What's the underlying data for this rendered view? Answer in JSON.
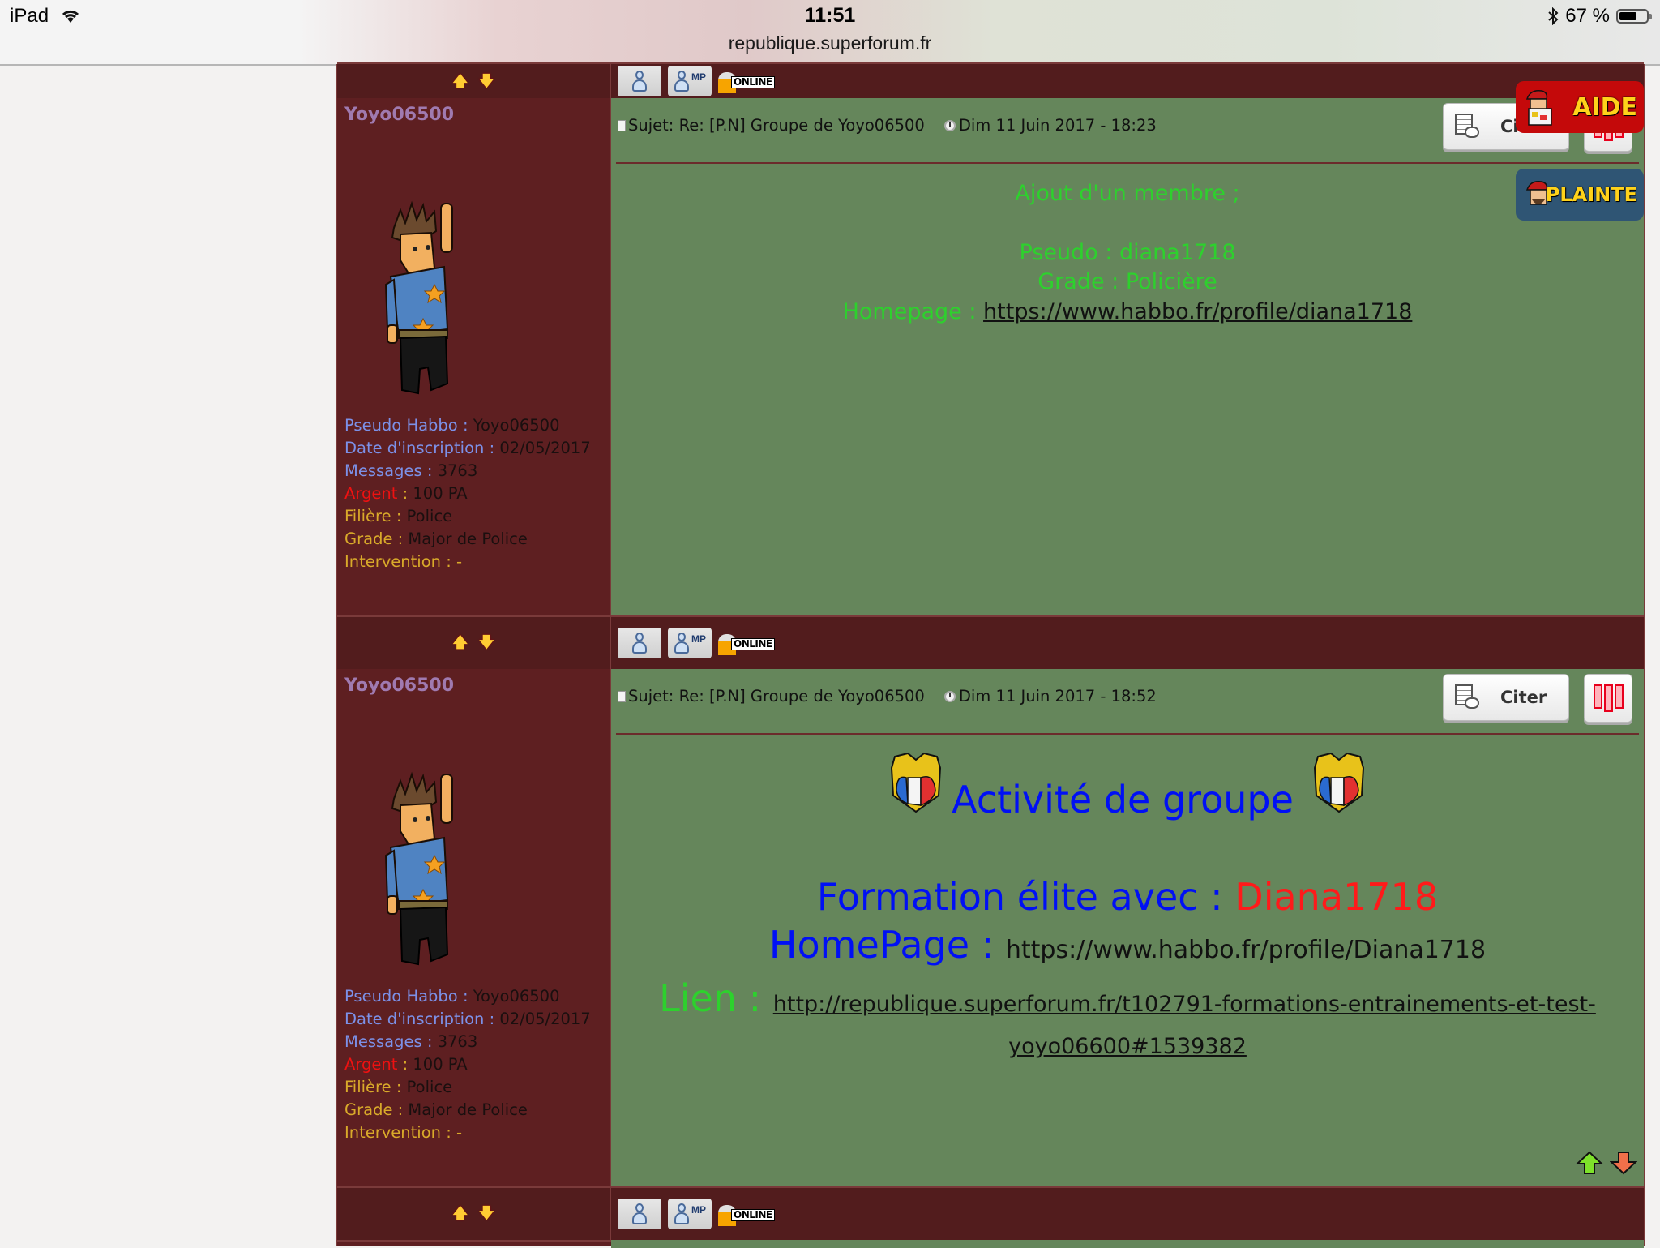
{
  "status_bar": {
    "device": "iPad",
    "time": "11:51",
    "battery_percent": "67 %",
    "battery_level": 0.67,
    "url": "republique.superforum.fr"
  },
  "icons": {
    "wifi": "wifi-icon",
    "bluetooth": "bluetooth-icon",
    "battery": "battery-icon",
    "nav_up": "arrow-up-icon",
    "nav_down": "arrow-down-icon",
    "profile": "profile-icon",
    "pm": "private-message-icon",
    "online": "online-status-icon",
    "subject": "document-icon",
    "clock": "clock-icon",
    "quote": "quote-icon",
    "report": "report-icon"
  },
  "post_bar": {
    "nav_up": "🡅",
    "nav_down": "🡇",
    "pm_label": "MP",
    "online_label": "ONLINE"
  },
  "floating_buttons": {
    "aide": "AIDE",
    "plainte": "PLAINTE"
  },
  "posts": [
    {
      "author": "Yoyo06500",
      "profile": {
        "pseudo_label": "Pseudo Habbo",
        "pseudo_value": "Yoyo06500",
        "date_label": "Date d'inscription",
        "date_value": "02/05/2017",
        "messages_label": "Messages",
        "messages_value": "3763",
        "argent_label": "Argent",
        "argent_value": "100 PA",
        "filiere_label": "Filière",
        "filiere_value": "Police",
        "grade_label": "Grade",
        "grade_value": "Major de Police",
        "intervention_label": "Intervention",
        "intervention_value": "-",
        "separator": " : "
      },
      "subject": "Sujet: Re: [P.N] Groupe de Yoyo06500",
      "date": "Dim 11 Juin 2017 - 18:23",
      "quote_label": "Citer",
      "body": {
        "line1": "Ajout d'un membre ;",
        "pseudo": "Pseudo : diana1718",
        "grade": "Grade : Policière",
        "homepage_label": "Homepage : ",
        "homepage_url": "https://www.habbo.fr/profile/diana1718"
      }
    },
    {
      "author": "Yoyo06500",
      "profile": {
        "pseudo_label": "Pseudo Habbo",
        "pseudo_value": "Yoyo06500",
        "date_label": "Date d'inscription",
        "date_value": "02/05/2017",
        "messages_label": "Messages",
        "messages_value": "3763",
        "argent_label": "Argent",
        "argent_value": "100 PA",
        "filiere_label": "Filière",
        "filiere_value": "Police",
        "grade_label": "Grade",
        "grade_value": "Major de Police",
        "intervention_label": "Intervention",
        "intervention_value": "-",
        "separator": " : "
      },
      "subject": "Sujet: Re: [P.N] Groupe de Yoyo06500",
      "date": "Dim 11 Juin 2017 - 18:52",
      "quote_label": "Citer",
      "body": {
        "title": "Activité de groupe",
        "formation_label": "Formation élite avec : ",
        "formation_name": "Diana1718",
        "homepage_label": "HomePage : ",
        "homepage_url": "https://www.habbo.fr/profile/Diana1718",
        "lien_label": "Lien : ",
        "lien_url": "http://republique.superforum.fr/t102791-formations-entrainements-et-test-yoyo06600#1539382"
      }
    }
  ],
  "colors": {
    "profile_bg": "#5e1f21",
    "bar_bg": "#521c1d",
    "content_bg": "#65865b",
    "username": "#a07ab0",
    "label_blue": "#7c91e8",
    "label_red": "#ee1111",
    "label_gold": "#d9aa2a",
    "text_green": "#2dd12d",
    "text_blue": "#0010f5",
    "text_red": "#ff1a1a"
  }
}
